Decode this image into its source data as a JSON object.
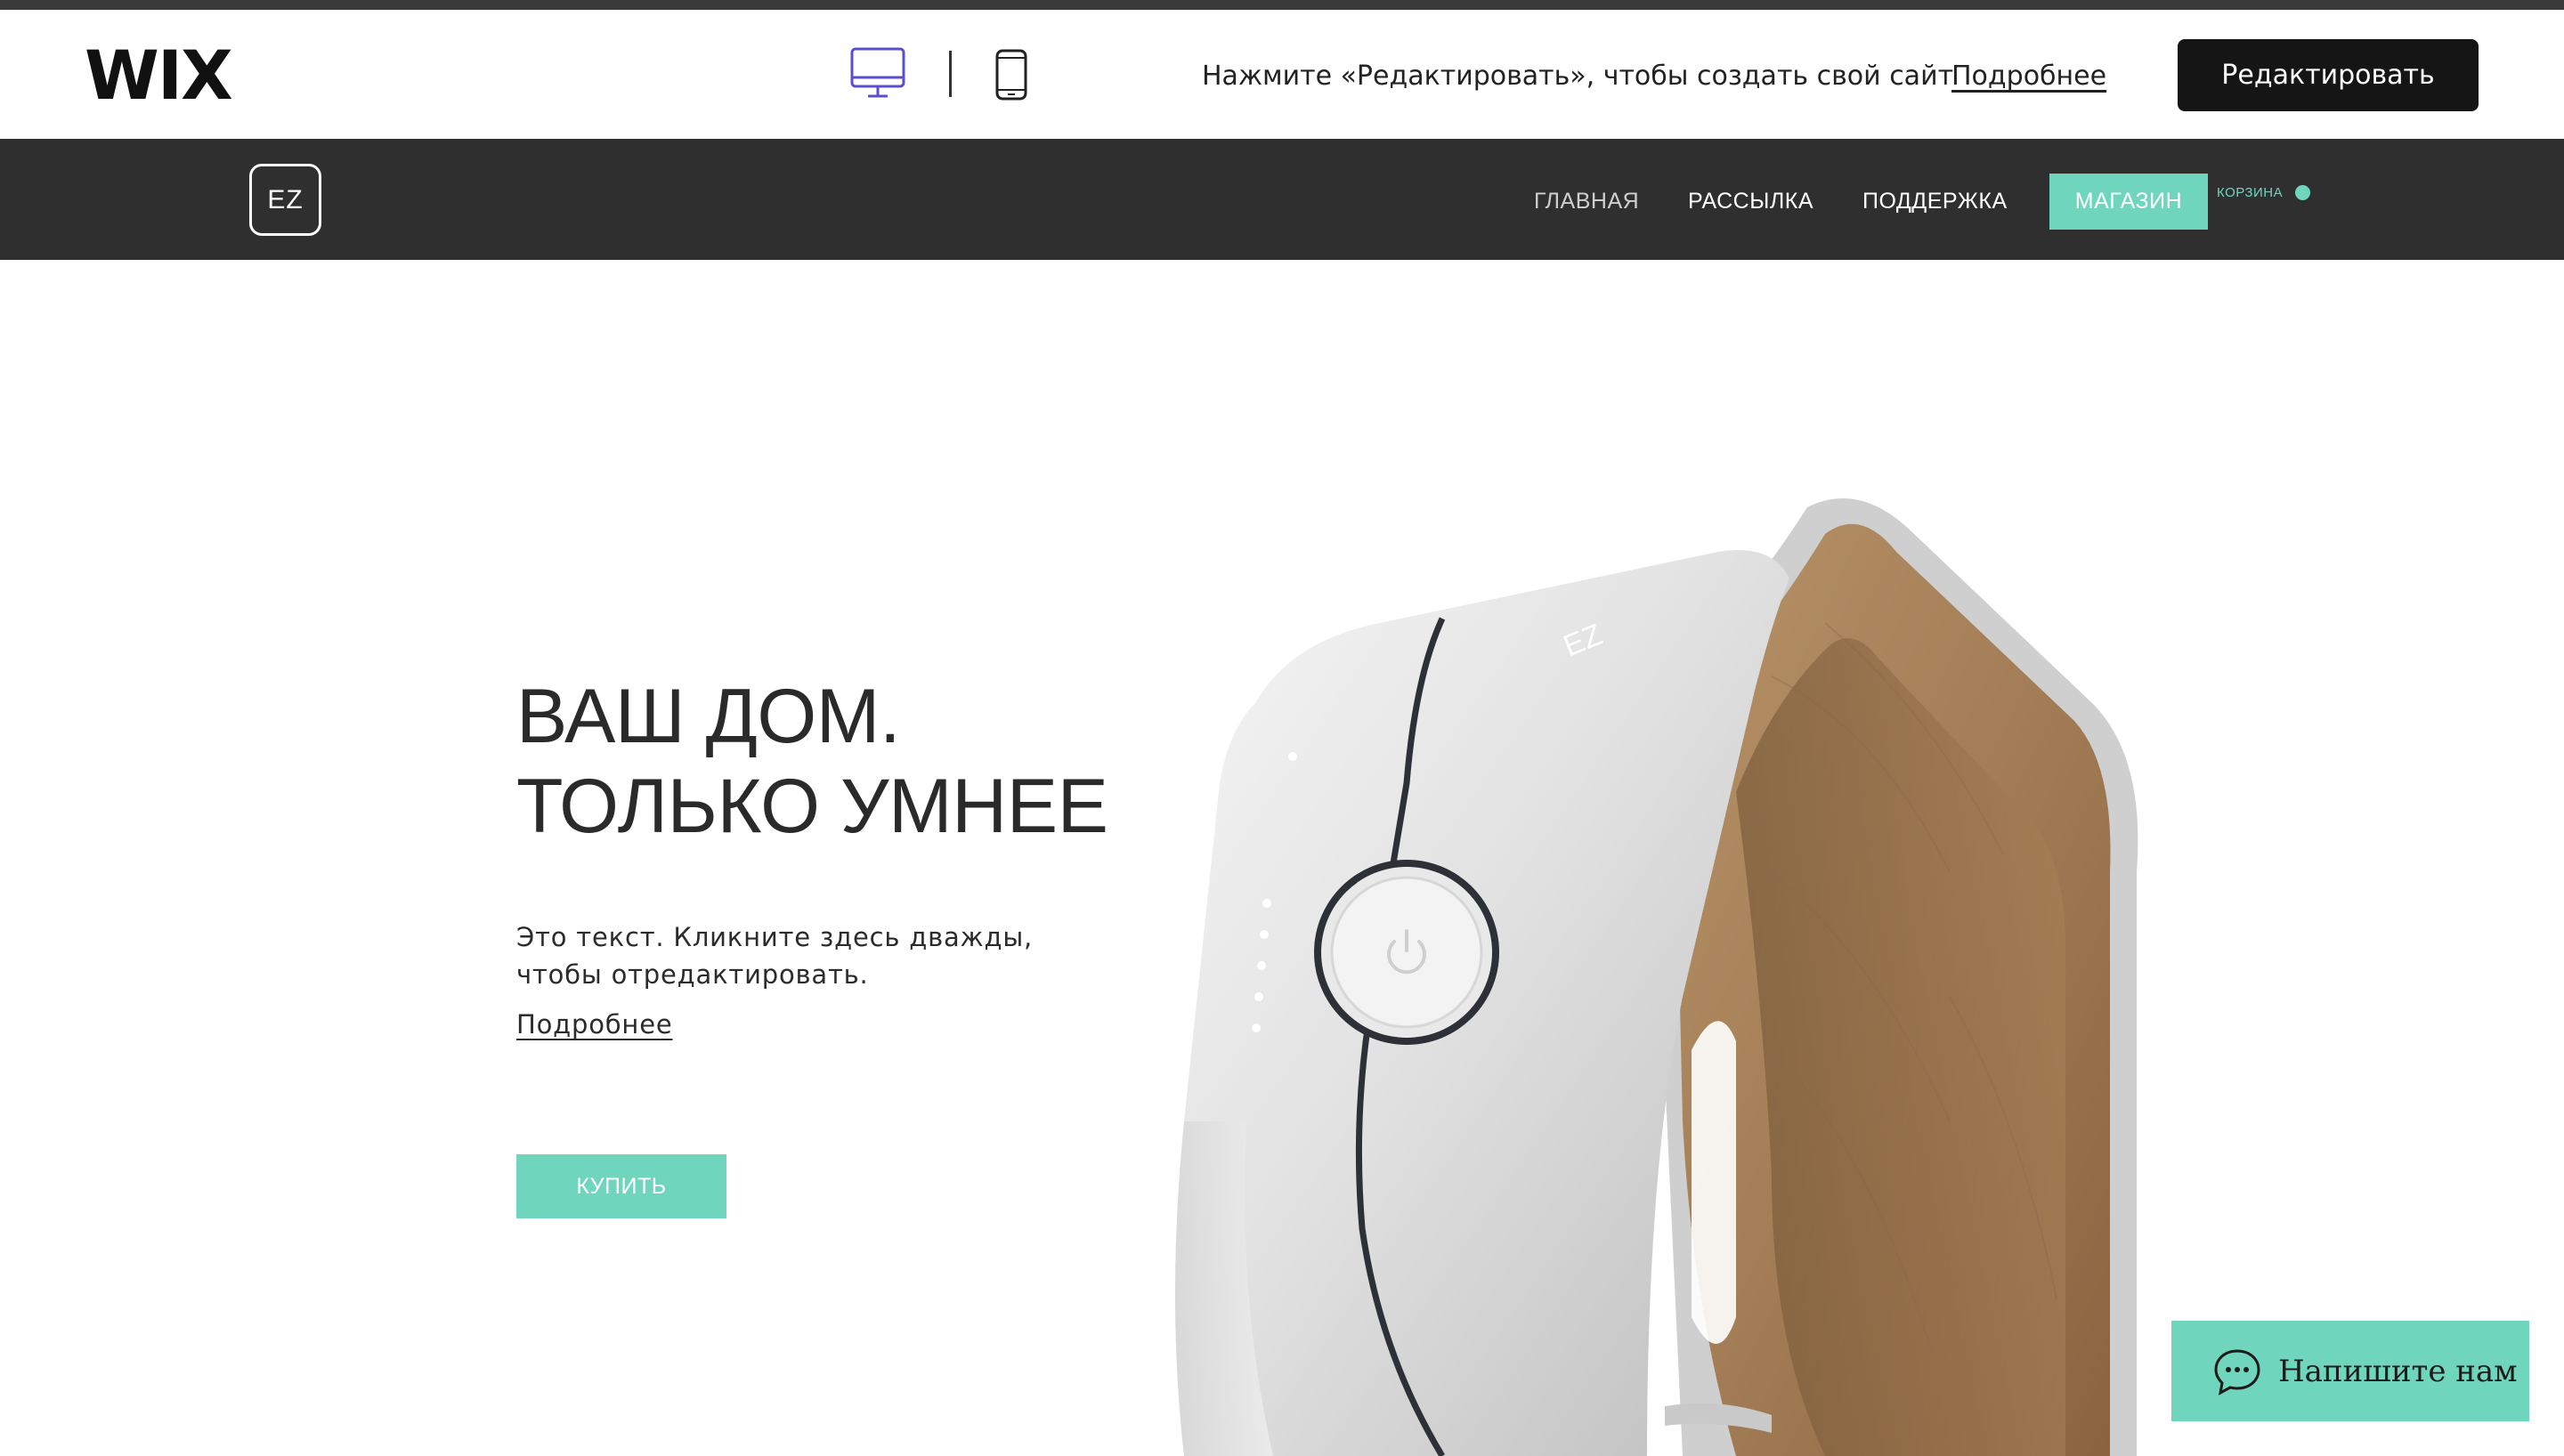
{
  "wix_bar": {
    "logo": "WIX",
    "message": "Нажмите «Редактировать», чтобы создать свой сайт",
    "more_link": "Подробнее",
    "edit_button": "Редактировать",
    "active_view": "desktop"
  },
  "site_header": {
    "logo": "EZ",
    "nav": [
      {
        "label": "ГЛАВНАЯ"
      },
      {
        "label": "РАССЫЛКА"
      },
      {
        "label": "ПОДДЕРЖКА"
      },
      {
        "label": "МАГАЗИН",
        "active": true
      }
    ],
    "cart_label": "КОРЗИНА"
  },
  "hero": {
    "title_line1": "ВАШ ДОМ.",
    "title_line2": "ТОЛЬКО УМНЕЕ",
    "text": "Это текст. Кликните здесь дважды, чтобы отредактировать.",
    "more_link": "Подробнее",
    "buy_button": "КУПИТЬ",
    "product_logo": "EZ"
  },
  "chat": {
    "label": "Напишите нам",
    "icon": "chat-bubble-icon"
  },
  "colors": {
    "accent": "#6fd6bd",
    "header_bg": "#2f2f2f",
    "wix_button_bg": "#151515",
    "device_icon_active": "#5b4fd0"
  }
}
